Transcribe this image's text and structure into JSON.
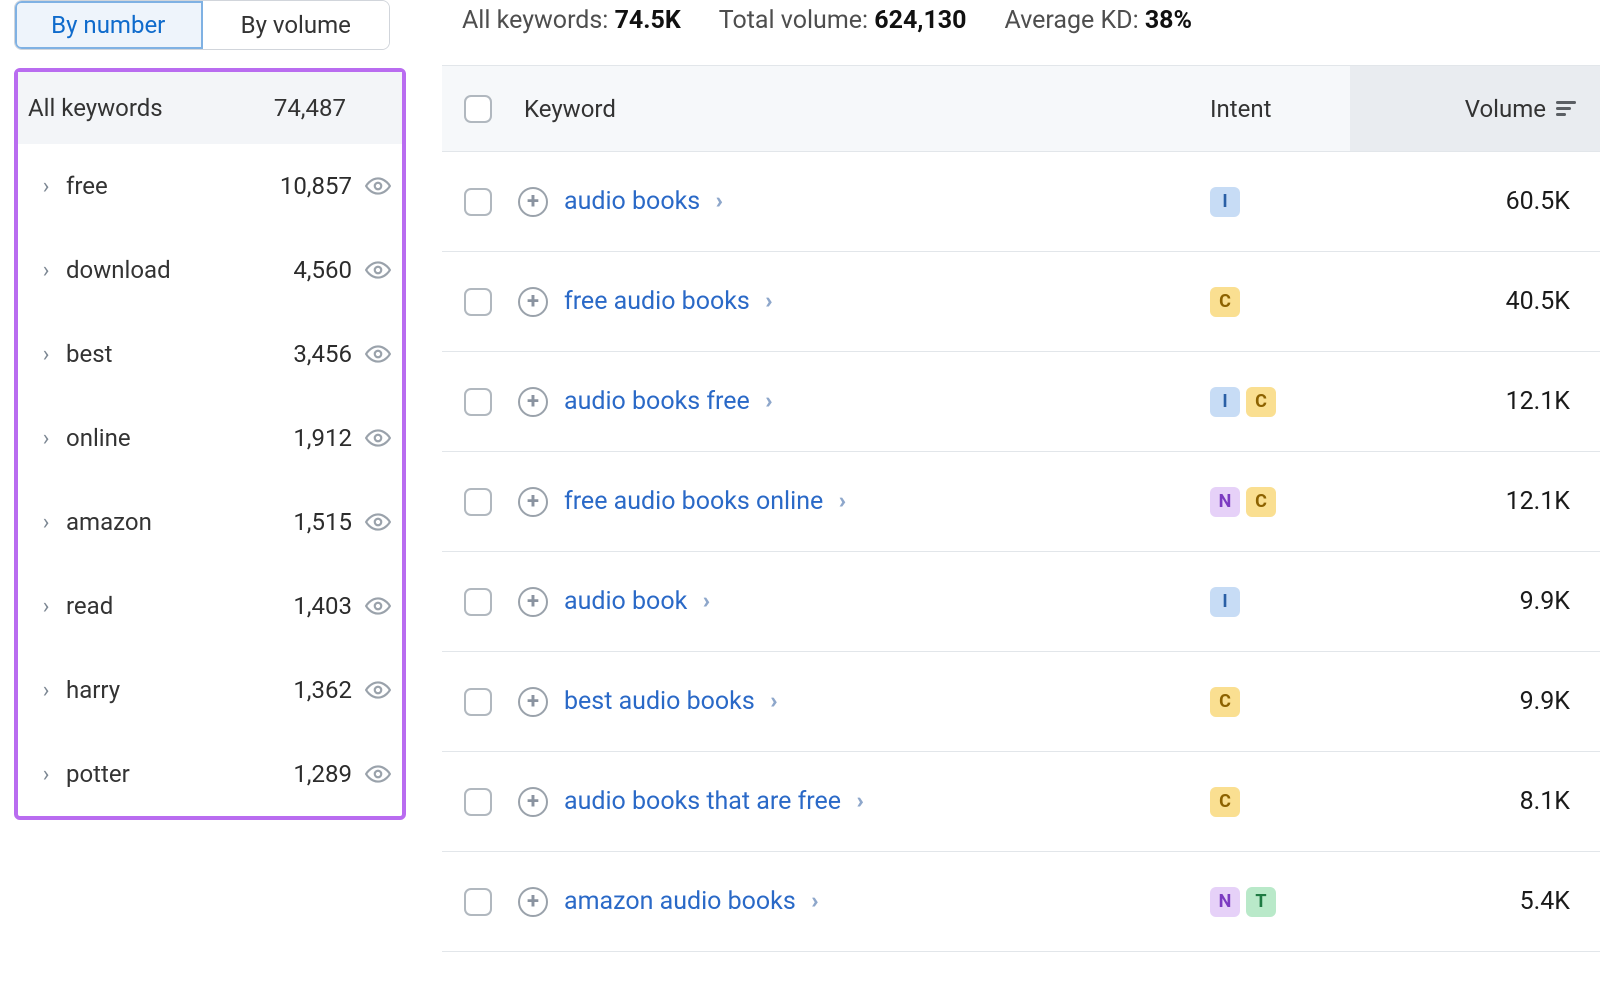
{
  "sidebar": {
    "toggles": {
      "by_number": "By number",
      "by_volume": "By volume"
    },
    "header": {
      "label": "All keywords",
      "count": "74,487"
    },
    "rows": [
      {
        "label": "free",
        "count": "10,857"
      },
      {
        "label": "download",
        "count": "4,560"
      },
      {
        "label": "best",
        "count": "3,456"
      },
      {
        "label": "online",
        "count": "1,912"
      },
      {
        "label": "amazon",
        "count": "1,515"
      },
      {
        "label": "read",
        "count": "1,403"
      },
      {
        "label": "harry",
        "count": "1,362"
      },
      {
        "label": "potter",
        "count": "1,289"
      }
    ]
  },
  "stats": {
    "all_keywords_label": "All keywords: ",
    "all_keywords_value": "74.5K",
    "total_volume_label": "Total volume: ",
    "total_volume_value": "624,130",
    "avg_kd_label": "Average KD: ",
    "avg_kd_value": "38%"
  },
  "table": {
    "headers": {
      "keyword": "Keyword",
      "intent": "Intent",
      "volume": "Volume"
    },
    "rows": [
      {
        "keyword": "audio books",
        "intents": [
          "I"
        ],
        "volume": "60.5K"
      },
      {
        "keyword": "free audio books",
        "intents": [
          "C"
        ],
        "volume": "40.5K"
      },
      {
        "keyword": "audio books free",
        "intents": [
          "I",
          "C"
        ],
        "volume": "12.1K"
      },
      {
        "keyword": "free audio books online",
        "intents": [
          "N",
          "C"
        ],
        "volume": "12.1K"
      },
      {
        "keyword": "audio book",
        "intents": [
          "I"
        ],
        "volume": "9.9K"
      },
      {
        "keyword": "best audio books",
        "intents": [
          "C"
        ],
        "volume": "9.9K"
      },
      {
        "keyword": "audio books that are free",
        "intents": [
          "C"
        ],
        "volume": "8.1K"
      },
      {
        "keyword": "amazon audio books",
        "intents": [
          "N",
          "T"
        ],
        "volume": "5.4K"
      }
    ]
  }
}
